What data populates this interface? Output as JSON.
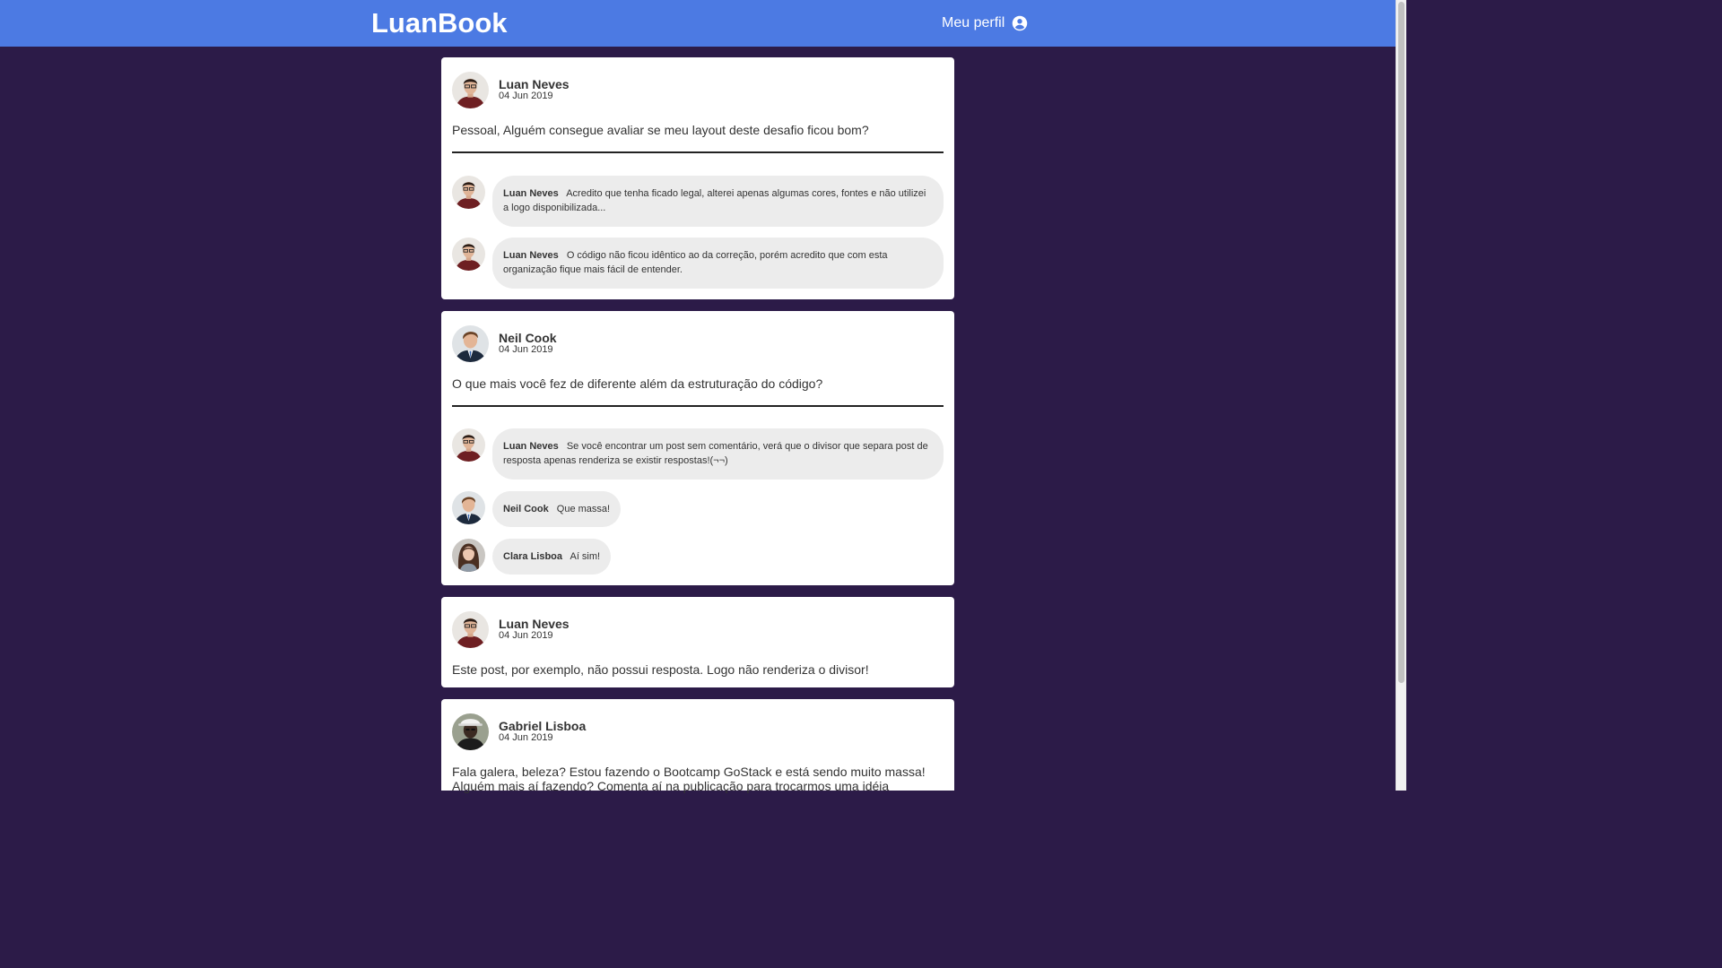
{
  "header": {
    "logo": "LuanBook",
    "profile_label": "Meu perfil",
    "profile_icon": "account-circle-icon"
  },
  "posts": [
    {
      "author": "Luan Neves",
      "avatar": "luan",
      "date": "04 Jun 2019",
      "content": "Pessoal, Alguém consegue avaliar se meu layout deste desafio ficou bom?",
      "comments": [
        {
          "author": "Luan Neves",
          "avatar": "luan",
          "text": "Acredito que tenha ficado legal, alterei apenas algumas cores, fontes e não utilizei a logo disponibilizada..."
        },
        {
          "author": "Luan Neves",
          "avatar": "luan",
          "text": "O código não ficou idêntico ao da correção, porém acredito que com esta organização fique mais fácil de entender."
        }
      ]
    },
    {
      "author": "Neil Cook",
      "avatar": "neil",
      "date": "04 Jun 2019",
      "content": "O que mais você fez de diferente além da estruturação do código?",
      "comments": [
        {
          "author": "Luan Neves",
          "avatar": "luan",
          "text": "Se você encontrar um post sem comentário, verá que o divisor que separa post de resposta apenas renderiza se existir respostas!(¬¬)"
        },
        {
          "author": "Neil Cook",
          "avatar": "neil",
          "text": "Que massa!"
        },
        {
          "author": "Clara Lisboa",
          "avatar": "clara",
          "text": "Aí sim!"
        }
      ]
    },
    {
      "author": "Luan Neves",
      "avatar": "luan",
      "date": "04 Jun 2019",
      "content": "Este post, por exemplo, não possui resposta. Logo não renderiza o divisor!",
      "comments": []
    },
    {
      "author": "Gabriel Lisboa",
      "avatar": "gabriel",
      "date": "04 Jun 2019",
      "content": "Fala galera, beleza? Estou fazendo o Bootcamp GoStack e está sendo muito massa! Alguém mais aí fazendo? Comenta aí na publicação para trocarmos uma idéia",
      "comments": []
    }
  ]
}
